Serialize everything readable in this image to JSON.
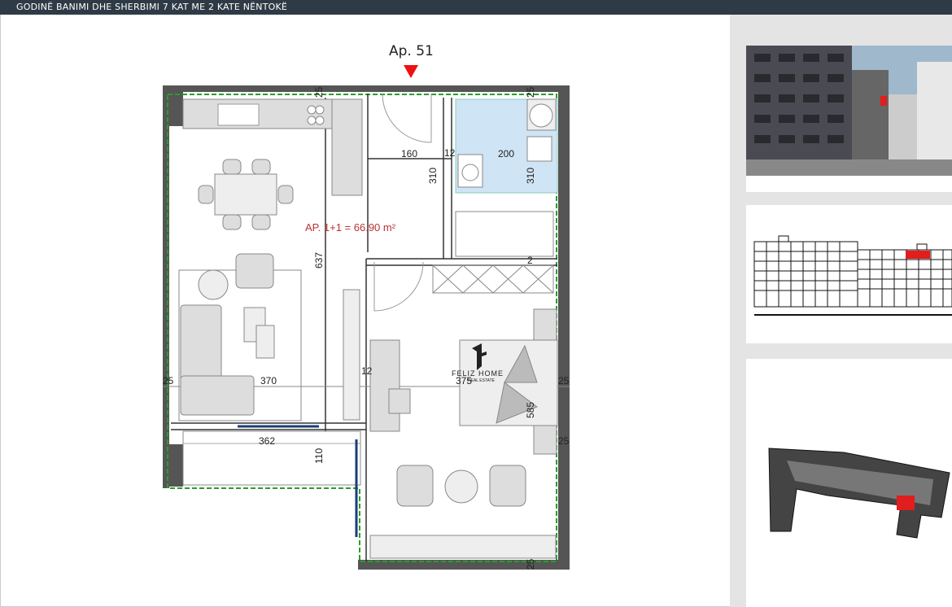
{
  "header": {
    "title": "GODINË BANIMI DHE SHERBIMI 7 KAT ME 2 KATE NËNTOKË"
  },
  "plan": {
    "apartment_label": "Ap. 51",
    "area_label": "AP. 1+1 = 66.90 m²",
    "brand_name": "FELIZ HOME",
    "brand_sub": "REAL ESTATE",
    "dimensions": {
      "d160": "160",
      "d200": "200",
      "d310a": "310",
      "d310b": "310",
      "d637": "637",
      "d370": "370",
      "d375": "375",
      "d585": "585",
      "d362": "362",
      "d110": "110",
      "d25a": "25",
      "d25b": "25",
      "d25c": "25",
      "d25d": "25",
      "d25e": "25",
      "d25f": "25",
      "d12a": "12",
      "d12b": "12",
      "d2": "2"
    }
  },
  "colors": {
    "header_bg": "#2e3a45",
    "highlight": "#e11d1d",
    "wall": "#555555",
    "green": "#2a9d2a",
    "tile": "#cfe4f5"
  }
}
